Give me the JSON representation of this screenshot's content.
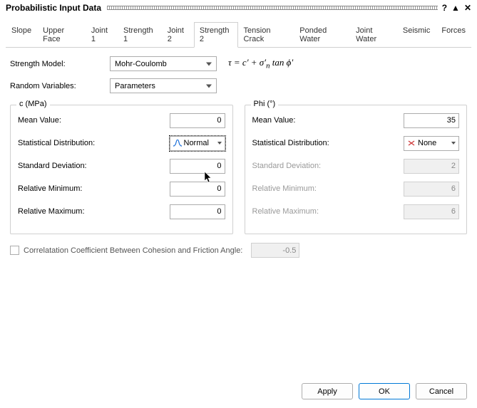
{
  "window": {
    "title": "Probabilistic Input Data",
    "help": "?",
    "collapse": "▲",
    "close": "✕"
  },
  "tabs": [
    "Slope",
    "Upper Face",
    "Joint 1",
    "Strength 1",
    "Joint 2",
    "Strength 2",
    "Tension Crack",
    "Ponded Water",
    "Joint Water",
    "Seismic",
    "Forces"
  ],
  "active_tab": "Strength 2",
  "main": {
    "strength_model_label": "Strength Model:",
    "strength_model_value": "Mohr-Coulomb",
    "random_vars_label": "Random Variables:",
    "random_vars_value": "Parameters"
  },
  "groups": {
    "c": {
      "legend": "c (MPa)",
      "mean_label": "Mean Value:",
      "mean_value": "0",
      "dist_label": "Statistical Distribution:",
      "dist_value": "Normal",
      "std_label": "Standard Deviation:",
      "std_value": "0",
      "relmin_label": "Relative Minimum:",
      "relmin_value": "0",
      "relmax_label": "Relative Maximum:",
      "relmax_value": "0"
    },
    "phi": {
      "legend": "Phi (°)",
      "mean_label": "Mean Value:",
      "mean_value": "35",
      "dist_label": "Statistical Distribution:",
      "dist_value": "None",
      "std_label": "Standard Deviation:",
      "std_value": "2",
      "relmin_label": "Relative Minimum:",
      "relmin_value": "6",
      "relmax_label": "Relative Maximum:",
      "relmax_value": "6"
    }
  },
  "correlation": {
    "label": "Correlatation Coefficient Between Cohesion and Friction Angle:",
    "value": "-0.5"
  },
  "buttons": {
    "apply": "Apply",
    "ok": "OK",
    "cancel": "Cancel"
  }
}
